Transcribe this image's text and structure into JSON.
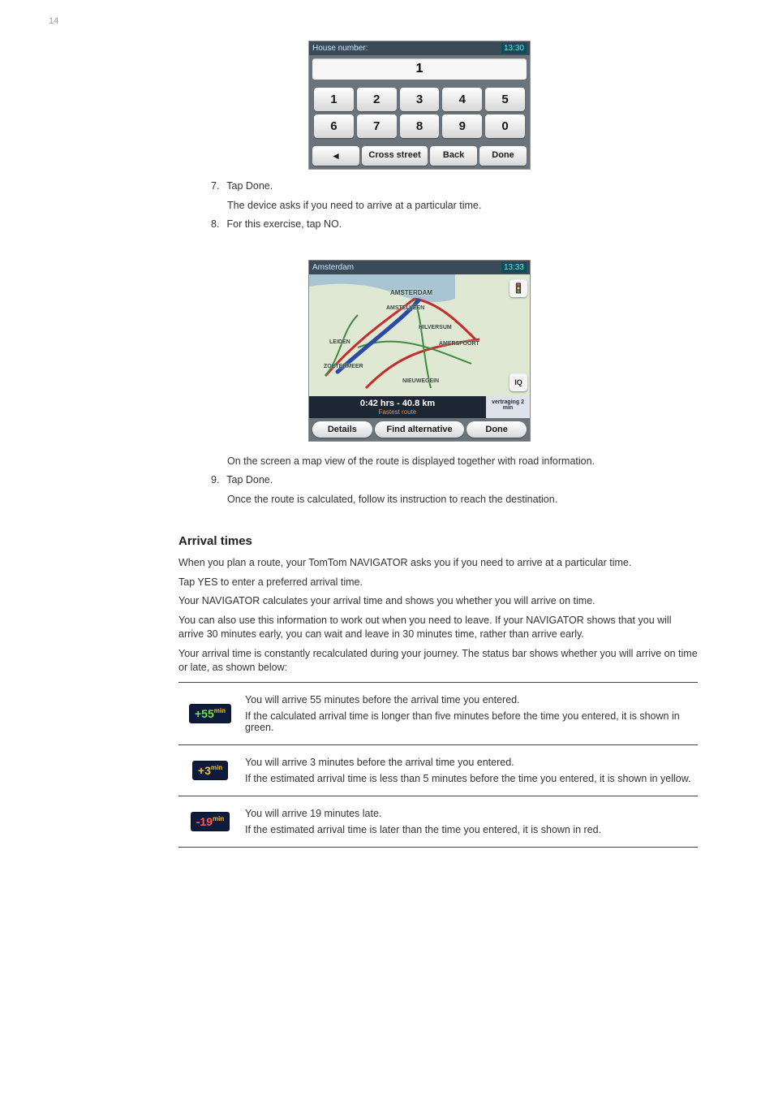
{
  "pageNumber": "14",
  "keypad": {
    "barTitle": "House number:",
    "barTime": "13:30",
    "value": "1",
    "keys": [
      "1",
      "2",
      "3",
      "4",
      "5",
      "6",
      "7",
      "8",
      "9",
      "0"
    ],
    "back_icon": "◄",
    "btn_cross_street": "Cross street",
    "btn_back": "Back",
    "btn_done": "Done"
  },
  "steps_a": [
    "Tap Done.",
    "The device asks if you need to arrive at a particular time.",
    "For this exercise, tap NO."
  ],
  "steps_a_nums": [
    "7.",
    "8."
  ],
  "map": {
    "barTitle": "Amsterdam",
    "barTime": "13:33",
    "labels": {
      "amsterdam": "AMSTERDAM",
      "amstelveen": "AMSTELVEEN",
      "hilversum": "HILVERSUM",
      "amersfoort": "AMERSFOORT",
      "leiden": "LEIDEN",
      "zoetermeer": "ZOETERMEER",
      "nieuwegein": "NIEUWEGEIN"
    },
    "side_iq": "IQ",
    "distanceLine": "0:42 hrs - 40.8 km",
    "routeTypeLine": "Fastest route",
    "sideInfo": "vertraging 2 min",
    "btn_details": "Details",
    "btn_find_alt": "Find alternative",
    "btn_done": "Done"
  },
  "steps_b": [
    "On the screen a map view of the route is displayed together with road information.",
    "Tap Done.",
    "Once the route is calculated, follow its instruction to reach the destination."
  ],
  "steps_b_nums": [
    "9."
  ],
  "heading_arrival": "Arrival times",
  "arrival_intro": [
    "When you plan a route, your TomTom NAVIGATOR asks you if you need to arrive at a particular time.",
    "Tap YES to enter a preferred arrival time.",
    "Your NAVIGATOR calculates your arrival time and shows you whether you will arrive on time.",
    "You can also use this information to work out when you need to leave. If your NAVIGATOR shows that you will arrive 30 minutes early, you can wait and leave in 30 minutes time, rather than arrive early.",
    "Your arrival time is constantly recalculated during your journey. The status bar shows whether you will arrive on time or late, as shown below:"
  ],
  "badges": [
    {
      "value": "+55",
      "unit": "min",
      "cls": "num-green",
      "desc": "You will arrive 55 minutes before the arrival time you entered.",
      "note": "If the calculated arrival time is longer than five minutes before the time you entered, it is shown in green."
    },
    {
      "value": "+3",
      "unit": "min",
      "cls": "num-yellow",
      "desc": "You will arrive 3 minutes before the arrival time you entered.",
      "note": "If the estimated arrival time is less than 5 minutes before the time you entered, it is shown in yellow."
    },
    {
      "value": "-19",
      "unit": "min",
      "cls": "num-red",
      "desc": "You will arrive 19 minutes late.",
      "note": "If the estimated arrival time is later than the time you entered, it is shown in red."
    }
  ]
}
